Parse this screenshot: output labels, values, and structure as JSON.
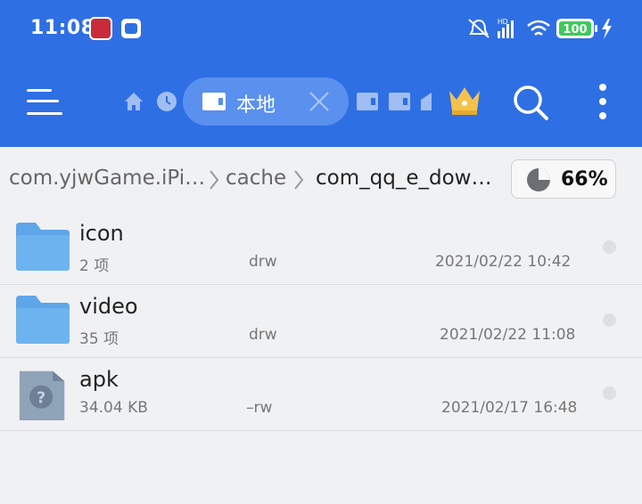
{
  "status_bar": {
    "time": "11:08",
    "battery": "100",
    "network_label": "HD"
  },
  "toolbar": {
    "tab_label": "本地",
    "icons": [
      "menu-icon",
      "home-icon",
      "clock-icon",
      "sd-card-icon",
      "close-icon",
      "crown-icon",
      "search-icon",
      "more-vertical-icon"
    ]
  },
  "breadcrumb": {
    "items": [
      "com.yjwGame.iPi…",
      "cache",
      "com_qq_e_dow…"
    ],
    "usage": "66%"
  },
  "files": [
    {
      "name": "icon",
      "meta": "2 项",
      "perm": "drw",
      "date": "2021/02/22 10:42",
      "type": "folder"
    },
    {
      "name": "video",
      "meta": "35 项",
      "perm": "drw",
      "date": "2021/02/22 11:08",
      "type": "folder"
    },
    {
      "name": "apk",
      "meta": "34.04 KB",
      "perm": "–rw",
      "date": "2021/02/17 16:48",
      "type": "unknown-file"
    }
  ],
  "colors": {
    "header": "#2f6fe4",
    "folder": "#5ea6e8",
    "background": "#f0f1f3"
  }
}
